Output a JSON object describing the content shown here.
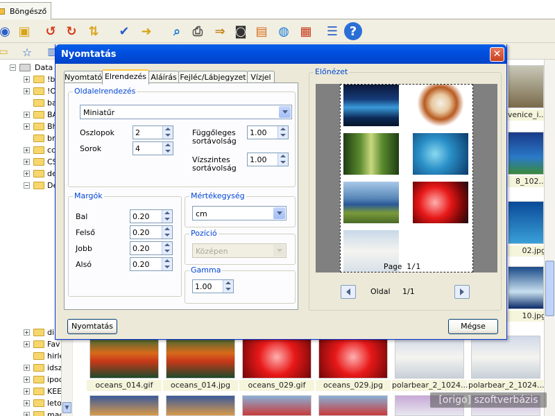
{
  "app": {
    "tab_title": "Böngésző",
    "tree": [
      {
        "label": "Data (",
        "expand": "-"
      },
      {
        "label": "!b",
        "expand": "+"
      },
      {
        "label": "!O",
        "expand": "+"
      },
      {
        "label": "ba",
        "expand": ""
      },
      {
        "label": "BA",
        "expand": "+"
      },
      {
        "label": "Bh",
        "expand": "+"
      },
      {
        "label": "bre",
        "expand": ""
      },
      {
        "label": "cc",
        "expand": "+"
      },
      {
        "label": "CS",
        "expand": "+"
      },
      {
        "label": "de",
        "expand": "+"
      },
      {
        "label": "De",
        "expand": "-"
      }
    ],
    "tree_lower": [
      {
        "label": "din",
        "expand": "+"
      },
      {
        "label": "Fav",
        "expand": "+"
      },
      {
        "label": "hirle",
        "expand": ""
      },
      {
        "label": "idsz",
        "expand": "+"
      },
      {
        "label": "ipod",
        "expand": "+"
      },
      {
        "label": "KEE",
        "expand": "+"
      },
      {
        "label": "leto",
        "expand": "+"
      },
      {
        "label": "mac",
        "expand": "+"
      }
    ],
    "right_labels": [
      "venice_i...",
      "8_102...",
      "02.jpg",
      "10.jpg"
    ],
    "thumb_labels": [
      "oceans_014.gif",
      "oceans_014.jpg",
      "oceans_029.gif",
      "oceans_029.jpg",
      "polarbear_2_1024...",
      "polarbear_2_1024..."
    ],
    "watermark": "[origo] szoftverbázis"
  },
  "dialog": {
    "title": "Nyomtatás",
    "tabs": [
      "Nyomtató",
      "Elrendezés",
      "Aláírás",
      "Fejléc/Lábjegyzet",
      "Vízjel"
    ],
    "active_tab": "Elrendezés",
    "page_layout": {
      "group_title": "Oldalelrendezés",
      "layout_mode": "Miniatűr",
      "columns_label": "Oszlopok",
      "columns_value": "2",
      "rows_label": "Sorok",
      "rows_value": "4",
      "vspacing_label_1": "Függőleges",
      "vspacing_label_2": "sortávolság",
      "vspacing_value": "1.00",
      "hspacing_label_1": "Vízszintes",
      "hspacing_label_2": "sortávolság",
      "hspacing_value": "1.00"
    },
    "margins": {
      "group_title": "Margók",
      "left_label": "Bal",
      "left_value": "0.20",
      "top_label": "Felső",
      "top_value": "0.20",
      "right_label": "Jobb",
      "right_value": "0.20",
      "bottom_label": "Alsó",
      "bottom_value": "0.20"
    },
    "unit": {
      "group_title": "Mértékegység",
      "value": "cm"
    },
    "position": {
      "group_title": "Pozíció",
      "value": "Középen"
    },
    "gamma": {
      "group_title": "Gamma",
      "value": "1.00"
    },
    "preview": {
      "group_title": "Előnézet",
      "page_label": "Page 1/1",
      "nav_label": "Oldal",
      "nav_value": "1/1"
    },
    "print_button": "Nyomtatás",
    "cancel_button": "Mégse"
  }
}
